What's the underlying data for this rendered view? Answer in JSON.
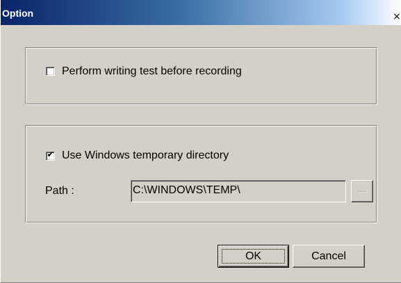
{
  "window": {
    "title": "Option",
    "close_glyph": "×"
  },
  "group_recording": {
    "writing_test": {
      "label": "Perform writing test before recording",
      "checked": false
    }
  },
  "group_temp": {
    "use_windows_temp": {
      "label": "Use Windows temporary directory",
      "checked": true,
      "check_glyph": "✔"
    },
    "path_label": "Path :",
    "path_value": "C:\\WINDOWS\\TEMP\\",
    "browse_label": "....",
    "browse_enabled": false
  },
  "buttons": {
    "ok_label": "OK",
    "cancel_label": "Cancel"
  },
  "colors": {
    "dialog_face": "#d4d0c8",
    "title_gradient_start": "#0a246a",
    "title_gradient_end": "#a6caf0",
    "disabled_text": "#808080"
  },
  "icons": {
    "close": "close-icon",
    "check": "check-icon"
  }
}
